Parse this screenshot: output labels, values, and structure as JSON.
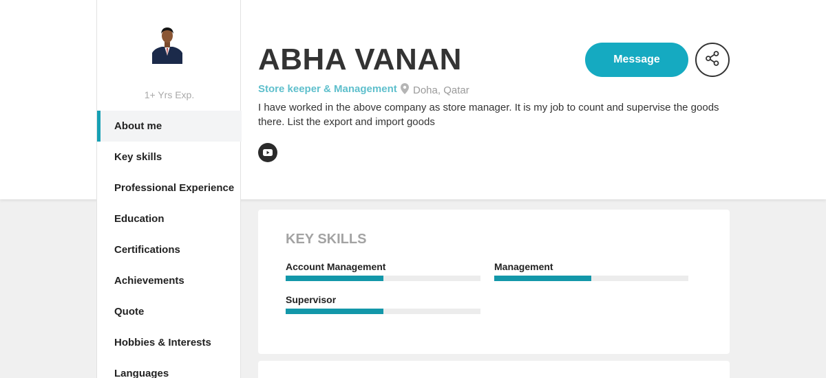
{
  "profile": {
    "name": "ABHA VANAN",
    "role": "Store keeper & Management",
    "location": "Doha, Qatar",
    "bio": "I have worked in the above company as store manager. It is my job to count and supervise the goods there. List the export and import goods",
    "experience": "1+ Yrs Exp."
  },
  "actions": {
    "message_label": "Message"
  },
  "sidebar": {
    "items": [
      {
        "label": "About me",
        "active": true
      },
      {
        "label": "Key skills"
      },
      {
        "label": "Professional Experience"
      },
      {
        "label": "Education"
      },
      {
        "label": "Certifications"
      },
      {
        "label": "Achievements"
      },
      {
        "label": "Quote"
      },
      {
        "label": "Hobbies & Interests"
      },
      {
        "label": "Languages"
      }
    ]
  },
  "key_skills": {
    "title": "KEY SKILLS",
    "skills": [
      {
        "label": "Account Management",
        "level": 0.5
      },
      {
        "label": "Management",
        "level": 0.5
      },
      {
        "label": "Supervisor",
        "level": 0.5
      }
    ]
  },
  "colors": {
    "accent": "#15aac1",
    "role_text": "#5ebfcc",
    "skill_fill": "#1397a9"
  },
  "icons": [
    "location-pin-icon",
    "youtube-icon",
    "share-icon"
  ]
}
